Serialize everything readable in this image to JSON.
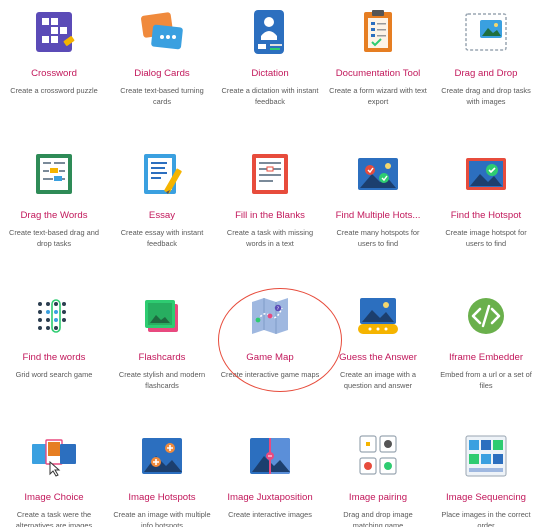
{
  "tiles": [
    {
      "id": "crossword",
      "title": "Crossword",
      "desc": "Create a crossword puzzle",
      "icon": "crossword-icon"
    },
    {
      "id": "dialog-cards",
      "title": "Dialog Cards",
      "desc": "Create text-based turning cards",
      "icon": "dialog-cards-icon"
    },
    {
      "id": "dictation",
      "title": "Dictation",
      "desc": "Create a dictation with instant feedback",
      "icon": "dictation-icon"
    },
    {
      "id": "documentation-tool",
      "title": "Documentation Tool",
      "desc": "Create a form wizard with text export",
      "icon": "documentation-tool-icon"
    },
    {
      "id": "drag-and-drop",
      "title": "Drag and Drop",
      "desc": "Create drag and drop tasks with images",
      "icon": "drag-and-drop-icon"
    },
    {
      "id": "drag-the-words",
      "title": "Drag the Words",
      "desc": "Create text-based drag and drop tasks",
      "icon": "drag-the-words-icon"
    },
    {
      "id": "essay",
      "title": "Essay",
      "desc": "Create essay with instant feedback",
      "icon": "essay-icon"
    },
    {
      "id": "fill-in-the-blanks",
      "title": "Fill in the Blanks",
      "desc": "Create a task with missing words in a text",
      "icon": "fill-in-the-blanks-icon"
    },
    {
      "id": "find-multiple-hotspots",
      "title": "Find Multiple Hots...",
      "desc": "Create many hotspots for users to find",
      "icon": "find-multiple-hotspots-icon"
    },
    {
      "id": "find-the-hotspot",
      "title": "Find the Hotspot",
      "desc": "Create image hotspot for users to find",
      "icon": "find-the-hotspot-icon"
    },
    {
      "id": "find-the-words",
      "title": "Find the words",
      "desc": "Grid word search game",
      "icon": "find-the-words-icon"
    },
    {
      "id": "flashcards",
      "title": "Flashcards",
      "desc": "Create stylish and modern flashcards",
      "icon": "flashcards-icon"
    },
    {
      "id": "game-map",
      "title": "Game Map",
      "desc": "Create interactive game maps",
      "icon": "game-map-icon"
    },
    {
      "id": "guess-the-answer",
      "title": "Guess the Answer",
      "desc": "Create an image with a question and answer",
      "icon": "guess-the-answer-icon"
    },
    {
      "id": "iframe-embedder",
      "title": "Iframe Embedder",
      "desc": "Embed from a url or a set of files",
      "icon": "iframe-embedder-icon"
    },
    {
      "id": "image-choice",
      "title": "Image Choice",
      "desc": "Create a task were the alternatives are images",
      "icon": "image-choice-icon"
    },
    {
      "id": "image-hotspots",
      "title": "Image Hotspots",
      "desc": "Create an image with multiple info hotspots",
      "icon": "image-hotspots-icon"
    },
    {
      "id": "image-juxtaposition",
      "title": "Image Juxtaposition",
      "desc": "Create interactive images",
      "icon": "image-juxtaposition-icon"
    },
    {
      "id": "image-pairing",
      "title": "Image pairing",
      "desc": "Drag and drop image matching game",
      "icon": "image-pairing-icon"
    },
    {
      "id": "image-sequencing",
      "title": "Image Sequencing",
      "desc": "Place images in the correct order",
      "icon": "image-sequencing-icon"
    }
  ],
  "colors": {
    "title": "#c2185b",
    "desc": "#5a5a5a",
    "highlight": "#e74c3c"
  }
}
